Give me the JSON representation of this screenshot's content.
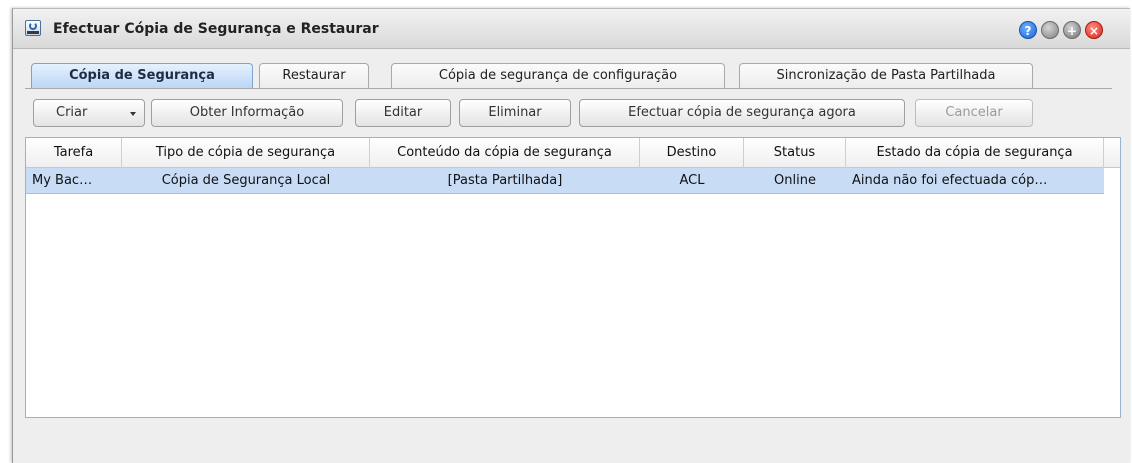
{
  "window": {
    "title": "Efectuar Cópia de Segurança e Restaurar",
    "icons": [
      "backup-app-icon",
      "help-icon",
      "minimize-icon",
      "maximize-icon",
      "close-icon"
    ],
    "help_glyph": "?",
    "max_glyph": "+",
    "close_glyph": "×"
  },
  "tabs": [
    {
      "label": "Cópia de Segurança",
      "active": true
    },
    {
      "label": "Restaurar",
      "active": false
    },
    {
      "label": "Cópia de segurança de configuração",
      "active": false
    },
    {
      "label": "Sincronização de Pasta Partilhada",
      "active": false
    }
  ],
  "toolbar": {
    "create_label": "Criar",
    "info_label": "Obter Informação",
    "edit_label": "Editar",
    "delete_label": "Eliminar",
    "backup_now_label": "Efectuar cópia de segurança agora",
    "cancel_label": "Cancelar"
  },
  "table": {
    "columns": [
      "Tarefa",
      "Tipo de cópia de segurança",
      "Conteúdo da cópia de segurança",
      "Destino",
      "Status",
      "Estado da cópia de segurança"
    ],
    "rows": [
      {
        "task": "My Bac…",
        "type": "Cópia de Segurança Local",
        "content": "[Pasta Partilhada]",
        "destination": "ACL",
        "status": "Online",
        "state": "Ainda não foi efectuada cóp…",
        "selected": true
      }
    ]
  },
  "colors": {
    "selection": "#c8dcf5",
    "active_tab": "#b9d5f5",
    "close_button": "#d8281c",
    "help_button": "#1b66d6"
  }
}
